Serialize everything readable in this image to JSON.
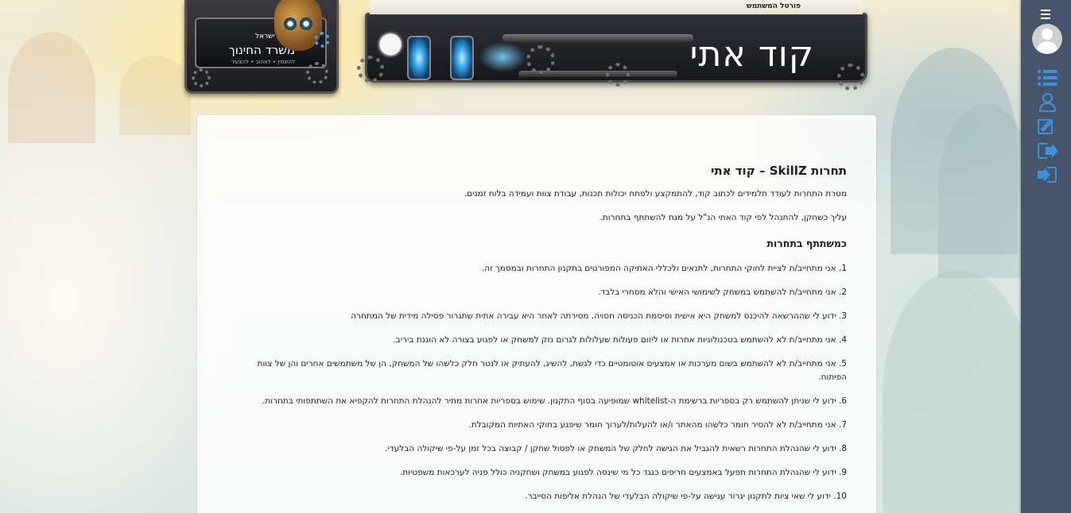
{
  "header": {
    "portal_label": "פורטל המשתמש",
    "title": "קוד אתי"
  },
  "logo": {
    "state": "מדינת ישראל",
    "ministry": "משרד החינוך",
    "motto": "להשמין • לאהוב • להצעיר"
  },
  "content": {
    "heading": "תחרות SkillZ – קוד אתי",
    "intro": "מטרת התחרות לעודד תלמידים לכתוב קוד, להתמקצע ולפתח יכולות תכנות, עבודת צוות ועמידה בלוח זמנים.",
    "instruction": "עליך כשחקן, להתנהל לפי קוד האתי הנ\"ל על מנת להשתתף בתחרות.",
    "subheading": "כמשתתף בתחרות",
    "rules": [
      "1. אני מתחייב/ת לציית לחוקי התחרות, לתנאים ולכללי האתיקה המפורטים בתקנון התחרות ובמסמך זה.",
      "2. אני מתחייב/ת להשתמש במשחק לשימושי האישי והלא מסחרי בלבד.",
      "3. ידוע לי שההרשאה להיכנס למשחק היא אישית וסיסמת הכניסה חסויה. מסירתה לאחר היא עבירה אתית שתגרור פסילה מידית של המתחרה",
      "4. אני מתחייב/ת לא להשתמש בטכנולוגיות אחרות או ליזום פעולות שעלולות לגרום נזק למשחק או לפגוע בצורה לא הוגנת ביריב.",
      "5. אני מתחייב/ת לא להשתמש בשום מערכות או אמצעים אוטומטיים כדי לגשת, להשיג, להעתיק או לנטר חלק כלשהו של המשחק, הן של משתמשים אחרים והן של צוות הפיתוח.",
      "6. ידוע לי שניתן להשתמש רק בספריות ברשימת ה-whitelist שמופיעה בסוף התקנון. שימוש בספריות אחרות מתיר להנהלת התחרות להקפיא את השתתפותי בתחרות.",
      "7. אני מתחייב/ת לא להסיר חומר כלשהו מהאתר ו/או להעלות/לערוך חומר שיפגע בחוקי האתיות המקובלת.",
      "8. ידוע לי שהנהלת התחרות רשאית להגביל את הגישה לחלק של המשחק או לפסול שחקן / קבוצה בכל זמן על-פי שיקולה הבלעדי.",
      "9. ידוע לי שהנהלת התחרות תפעל באמצעים חריפים כנגד כל מי שינסה לפגוע במשחק ושחקניה כולל פניה לערכאות משפטיות.",
      "10. ידוע לי שאי ציות לתקנון יגרור ענישה על-פי שיקולה הבלעדי של הנהלת אליפות הסייבר."
    ]
  },
  "sidebar": {
    "icons": [
      "menu-icon",
      "avatar",
      "list-icon",
      "user-icon",
      "edit-icon",
      "logout-icon",
      "login-icon"
    ],
    "bg_color": "#46556a",
    "accent": "#3d8fdf"
  }
}
